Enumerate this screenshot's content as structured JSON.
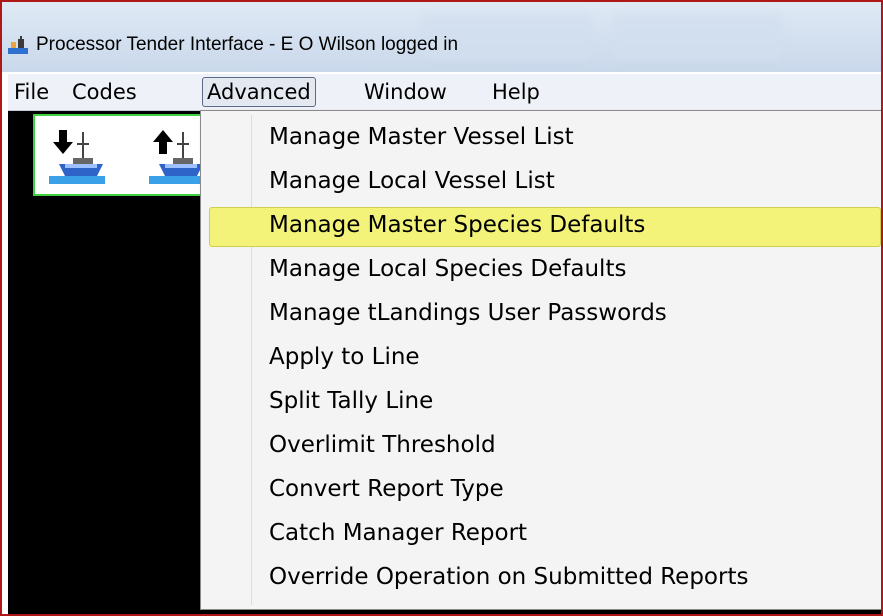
{
  "window": {
    "title": "Processor Tender Interface - E O Wilson logged in"
  },
  "menubar": {
    "items": [
      "File",
      "Codes",
      "Advanced",
      "Window",
      "Help"
    ],
    "active": "Advanced"
  },
  "toolbar": {
    "buttons": [
      {
        "icon": "download-vessel-icon"
      },
      {
        "icon": "upload-vessel-icon"
      }
    ]
  },
  "advanced_menu": {
    "highlighted": "Manage Master Species Defaults",
    "items": [
      "Manage Master Vessel List",
      "Manage Local Vessel List",
      "Manage Master Species Defaults",
      "Manage Local Species Defaults",
      "Manage tLandings User Passwords",
      "Apply to Line",
      "Split Tally Line",
      "Overlimit Threshold",
      "Convert Report Type",
      "Catch Manager Report",
      "Override Operation on Submitted Reports"
    ]
  },
  "colors": {
    "window_border": "#b01818",
    "highlight": "#f3f37a",
    "toolbar_border": "#40d040"
  }
}
